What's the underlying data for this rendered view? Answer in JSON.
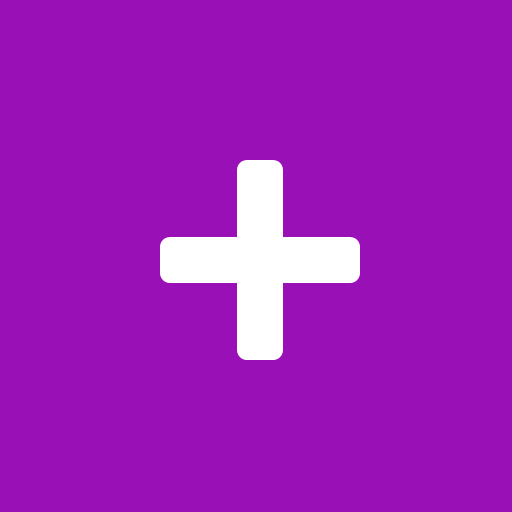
{
  "app_icon": {
    "background_color": "#9810B6",
    "glyph": "plus-icon",
    "glyph_color": "#FFFFFF"
  }
}
